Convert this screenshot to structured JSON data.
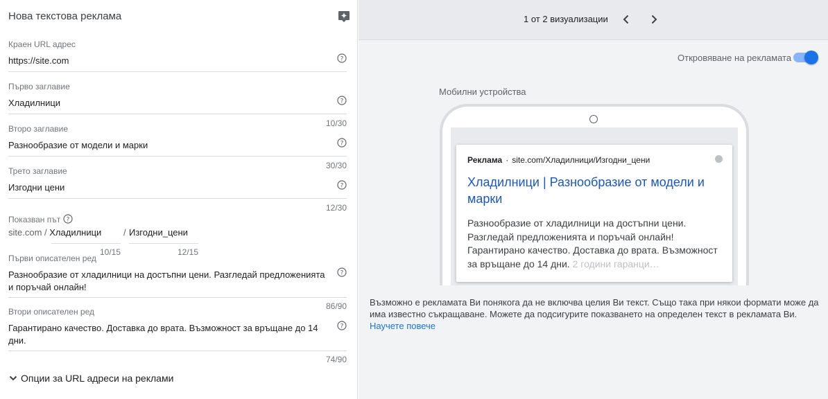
{
  "form": {
    "title": "Нова текстова реклама",
    "final_url": {
      "label": "Краен URL адрес",
      "value": "https://site.com"
    },
    "headline1": {
      "label": "Първо заглавие",
      "value": "Хладилници",
      "counter": "10/30"
    },
    "headline2": {
      "label": "Второ заглавие",
      "value": "Разнообразие от модели и марки",
      "counter": "30/30"
    },
    "headline3": {
      "label": "Трето заглавие",
      "value": "Изгодни цени",
      "counter": "12/30"
    },
    "display_path": {
      "label": "Показван път",
      "prefix": "site.com /",
      "path1": "Хладилници",
      "separator": "/",
      "path2": "Изгодни_цени",
      "path1_counter": "10/15",
      "path2_counter": "12/15"
    },
    "description1": {
      "label": "Първи описателен ред",
      "value": "Разнообразие от хладилници на достъпни цени. Разгледай предложенията и поръчай онлайн!",
      "counter": "86/90"
    },
    "description2": {
      "label": "Втори описателен ред",
      "value": "Гарантирано качество. Доставка до врата.  Възможност за връщане до 14 дни.",
      "counter": "74/90"
    },
    "url_options_label": "Опции за URL адреси на реклами"
  },
  "preview": {
    "pager_text": "1 от 2 визуализации",
    "expand_label": "Откровяване на рекламата",
    "expand_on": true,
    "device_label": "Мобилни устройства",
    "ad": {
      "badge": "Реклама",
      "dot": "·",
      "display_url": "site.com/Хладилници/Изгодни_цени",
      "title": "Хладилници | Разнообразие от модели и марки",
      "description": "Разнообразие от хладилници на достъпни цени. Разгледай предложенията и поръчай онлайн! Гарантирано качество. Доставка до врата. Възможност за връщане до 14 дни.",
      "faded_text": "2 години гаранци…"
    },
    "disclaimer": "Възможно е рекламата Ви понякога да не включва целия Ви текст. Също така при някои формати може да има известно съкращаване. Можете да подсигурите показването на определен текст в рекламата Ви.",
    "learn_more": "Научете повече"
  },
  "icons": {
    "sparkle": "sparkle-icon",
    "help": "help-circle-icon",
    "chevron_left": "chevron-left-icon",
    "chevron_right": "chevron-right-icon",
    "expand": "chevron-down-icon"
  },
  "colors": {
    "accent": "#1a73e8",
    "ad_title": "#1a56c7",
    "toggle_track": "#8ab4f8"
  }
}
